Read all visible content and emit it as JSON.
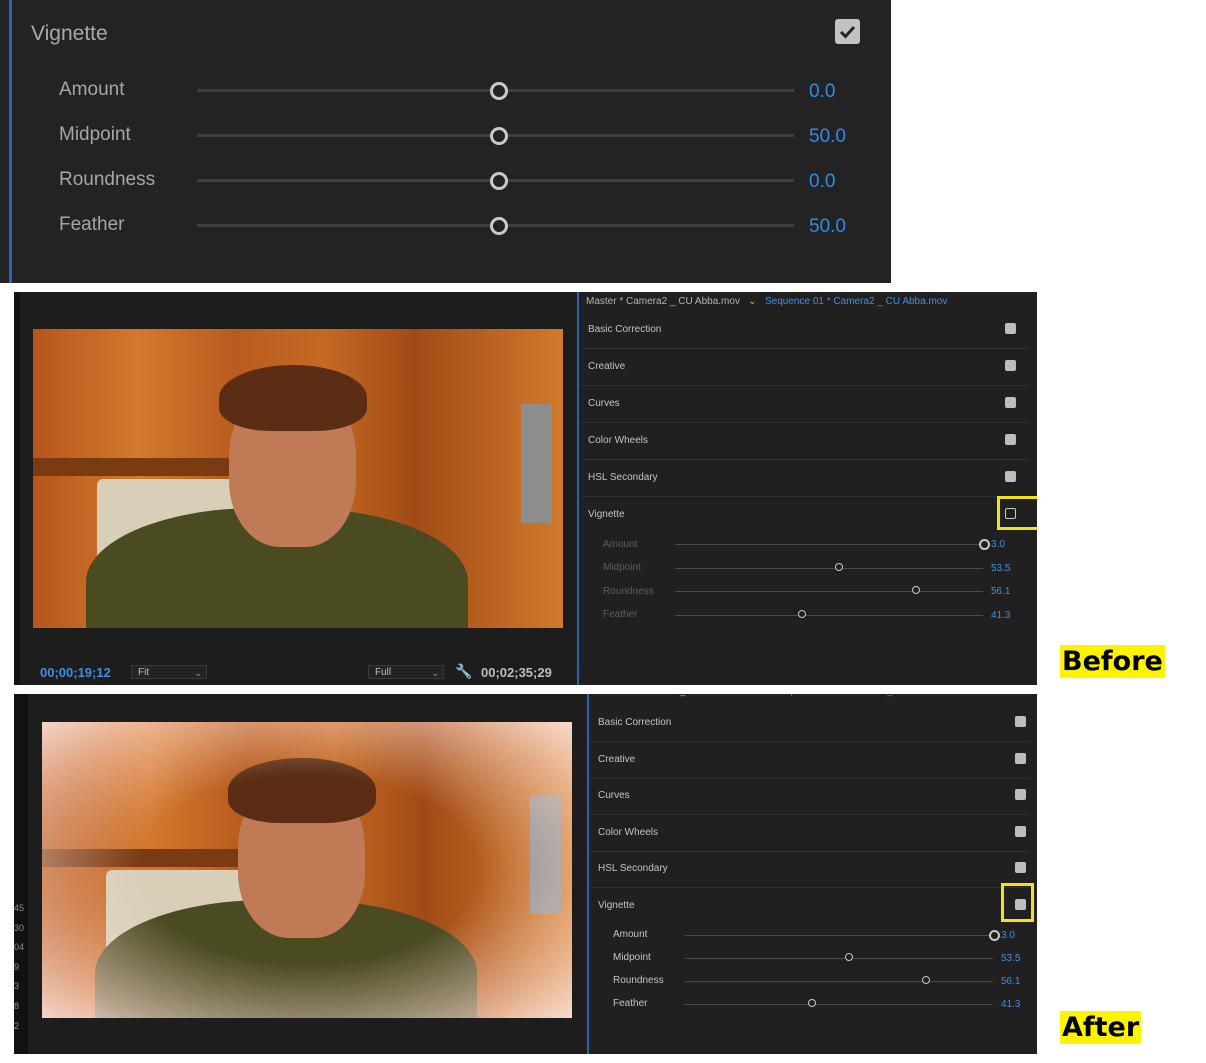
{
  "top_panel": {
    "title": "Vignette",
    "enabled": true,
    "sliders": [
      {
        "label": "Amount",
        "value": "0.0"
      },
      {
        "label": "Midpoint",
        "value": "50.0"
      },
      {
        "label": "Roundness",
        "value": "0.0"
      },
      {
        "label": "Feather",
        "value": "50.0"
      }
    ]
  },
  "monitor": {
    "current_time": "00;00;19;12",
    "zoom": "Fit",
    "resolution": "Full",
    "duration": "00;02;35;29"
  },
  "lumetri": {
    "master": "Master * Camera2 _ CU Abba.mov",
    "sequence": "Sequence 01 * Camera2 _ CU Abba.mov",
    "sections": [
      "Basic Correction",
      "Creative",
      "Curves",
      "Color Wheels",
      "HSL Secondary",
      "Vignette"
    ],
    "vignette_sliders": [
      {
        "label": "Amount",
        "value": "3.0",
        "pos": 1.0
      },
      {
        "label": "Midpoint",
        "value": "53.5",
        "pos": 0.535
      },
      {
        "label": "Roundness",
        "value": "56.1",
        "pos": 0.78
      },
      {
        "label": "Feather",
        "value": "41.3",
        "pos": 0.413
      }
    ]
  },
  "before": {
    "label": "Before",
    "vignette_enabled": false
  },
  "after": {
    "label": "After",
    "vignette_enabled": true
  },
  "after_ruler_ticks": [
    "45",
    "30",
    "04",
    "9",
    "3",
    "8",
    "2"
  ],
  "colors": {
    "accent": "#2d8ceb",
    "highlight": "#fdf200",
    "panel": "#202020"
  }
}
